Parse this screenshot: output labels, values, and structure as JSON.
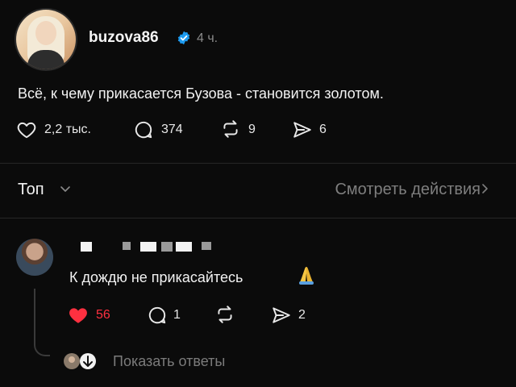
{
  "post": {
    "username": "buzova86",
    "time": "4 ч.",
    "text": "Всё, к чему прикасается Бузова - становится золотом.",
    "stats": {
      "likes": "2,2 тыс.",
      "comments": "374",
      "reposts": "9",
      "shares": "6"
    }
  },
  "filter": {
    "sort_label": "Топ",
    "view_actions": "Смотреть действия"
  },
  "comment": {
    "text": "К дождю не прикасайтесь",
    "emoji_name": "folded-hands-icon",
    "stats": {
      "likes": "56",
      "comments": "1",
      "shares": "2"
    },
    "show_replies": "Показать ответы"
  },
  "colors": {
    "background": "#0b0b0b",
    "verified": "#1d9bf0",
    "liked": "#ff3040",
    "muted": "#7e7e7e"
  }
}
